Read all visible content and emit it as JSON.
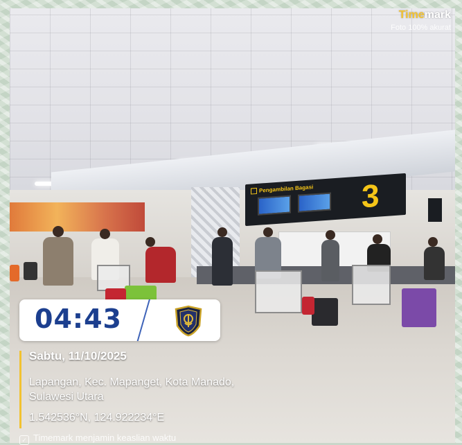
{
  "watermark": {
    "brand_prefix": "Time",
    "brand_suffix": "mark",
    "subtitle": "Foto 100% akurat"
  },
  "sign": {
    "label": "Pengambilan Bagasi",
    "number": "3"
  },
  "time_card": {
    "time": "04:43",
    "emblem_icon": "police-emblem-icon"
  },
  "info": {
    "date": "Sabtu, 11/10/2025",
    "address_line1": "Lapangan, Kec. Mapanget, Kota Manado,",
    "address_line2": "Sulawesi Utara",
    "coordinates": "1.542536°N, 124.922234°E"
  },
  "footer": {
    "text": "Timemark menjamin keaslian waktu",
    "icon": "shield-check-icon"
  },
  "colors": {
    "accent_yellow": "#f2c230",
    "time_blue": "#1c3f8f"
  }
}
